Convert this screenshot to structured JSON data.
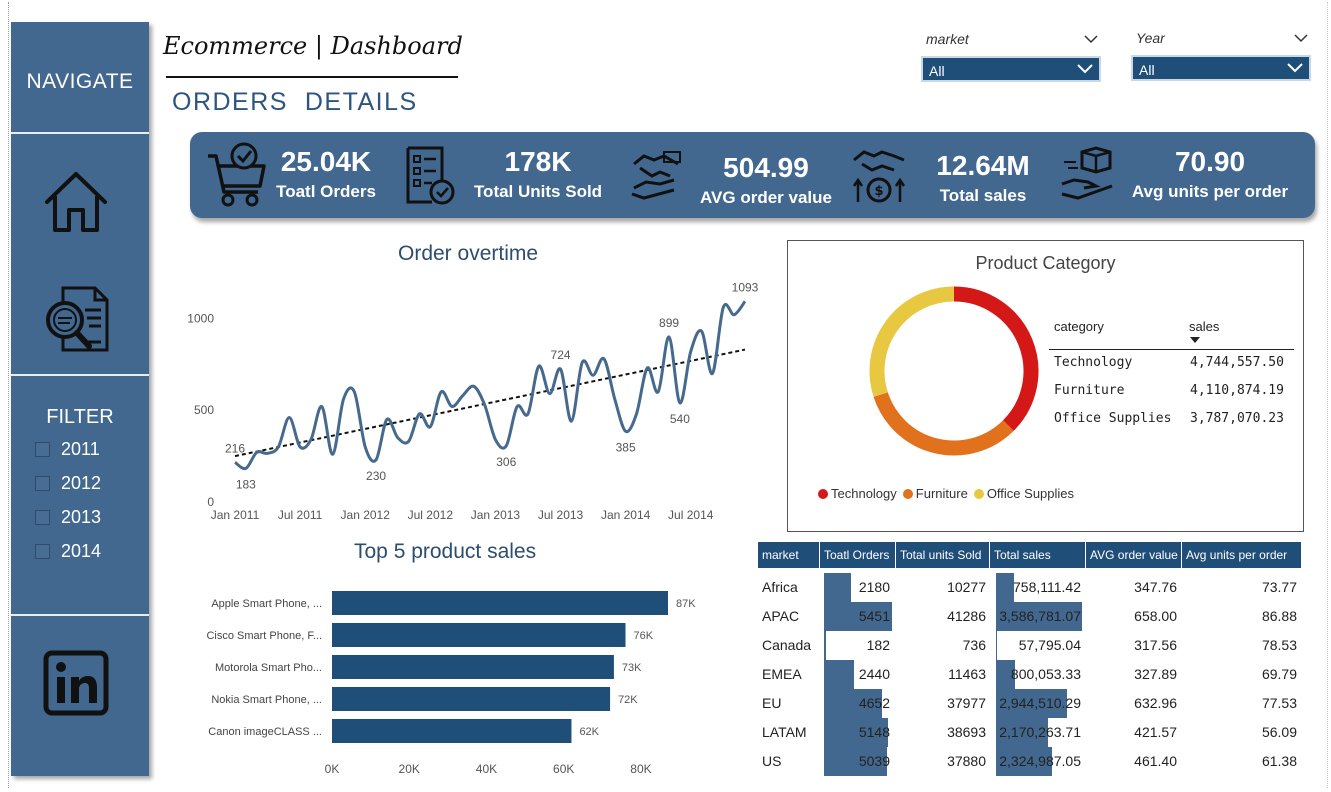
{
  "header": {
    "title": "Ecommerce | Dashboard",
    "section": "ORDERS  DETAILS"
  },
  "sidebar": {
    "navigate_label": "NAVIGATE",
    "filter_label": "FILTER",
    "years": [
      "2011",
      "2012",
      "2013",
      "2014"
    ],
    "icons": [
      "home-icon",
      "report-search-icon",
      "linkedin-icon"
    ]
  },
  "slicers": {
    "market": {
      "label": "market",
      "value": "All"
    },
    "year": {
      "label": "Year",
      "value": "All"
    }
  },
  "kpis": [
    {
      "value": "25.04K",
      "label": "Toatl Orders",
      "icon": "cart-icon"
    },
    {
      "value": "178K",
      "label": "Total Units Sold",
      "icon": "checklist-icon"
    },
    {
      "value": "504.99",
      "label": "AVG order value",
      "icon": "handshake-money-icon"
    },
    {
      "value": "12.64M",
      "label": "Total sales",
      "icon": "handshake-dollar-icon"
    },
    {
      "value": "70.90",
      "label": "Avg units per order",
      "icon": "box-hand-icon"
    }
  ],
  "colors": {
    "brand": "#426890",
    "dark": "#1f4e79",
    "technology": "#d41818",
    "furniture": "#e2711d",
    "office_supplies": "#e8c840"
  },
  "order_overtime": {
    "title": "Order overtime",
    "chart_data": {
      "type": "line",
      "x_ticks": [
        "Jan 2011",
        "Jul 2011",
        "Jan 2012",
        "Jul 2012",
        "Jan 2013",
        "Jul 2013",
        "Jan 2014",
        "Jul 2014"
      ],
      "y_ticks": [
        "0",
        "500",
        "1000"
      ],
      "ylim": [
        0,
        1100
      ],
      "months": [
        "Jan 2011",
        "Feb 2011",
        "Mar 2011",
        "Apr 2011",
        "May 2011",
        "Jun 2011",
        "Jul 2011",
        "Aug 2011",
        "Sep 2011",
        "Oct 2011",
        "Nov 2011",
        "Dec 2011",
        "Jan 2012",
        "Feb 2012",
        "Mar 2012",
        "Apr 2012",
        "May 2012",
        "Jun 2012",
        "Jul 2012",
        "Aug 2012",
        "Sep 2012",
        "Oct 2012",
        "Nov 2012",
        "Dec 2012",
        "Jan 2013",
        "Feb 2013",
        "Mar 2013",
        "Apr 2013",
        "May 2013",
        "Jun 2013",
        "Jul 2013",
        "Aug 2013",
        "Sep 2013",
        "Oct 2013",
        "Nov 2013",
        "Dec 2013",
        "Jan 2014",
        "Feb 2014",
        "Mar 2014",
        "Apr 2014",
        "May 2014",
        "Jun 2014",
        "Jul 2014",
        "Aug 2014",
        "Sep 2014",
        "Oct 2014",
        "Nov 2014",
        "Dec 2014"
      ],
      "values": [
        216,
        183,
        270,
        265,
        300,
        460,
        300,
        340,
        520,
        260,
        560,
        600,
        300,
        230,
        450,
        350,
        330,
        480,
        410,
        600,
        520,
        580,
        630,
        530,
        340,
        306,
        520,
        480,
        740,
        590,
        724,
        440,
        760,
        690,
        780,
        560,
        385,
        480,
        730,
        600,
        899,
        540,
        820,
        930,
        700,
        1060,
        1020,
        1093
      ],
      "data_labels": [
        {
          "index": 0,
          "text": "216",
          "pos": "above"
        },
        {
          "index": 1,
          "text": "183",
          "pos": "below"
        },
        {
          "index": 13,
          "text": "230",
          "pos": "below"
        },
        {
          "index": 25,
          "text": "306",
          "pos": "below"
        },
        {
          "index": 30,
          "text": "724",
          "pos": "above"
        },
        {
          "index": 36,
          "text": "385",
          "pos": "below"
        },
        {
          "index": 40,
          "text": "899",
          "pos": "above"
        },
        {
          "index": 41,
          "text": "540",
          "pos": "below"
        },
        {
          "index": 47,
          "text": "1093",
          "pos": "above"
        }
      ],
      "trendline": {
        "start": 250,
        "end": 830
      }
    }
  },
  "product_category": {
    "title": "Product Category",
    "col_category": "category",
    "col_sales": "sales",
    "chart_data": {
      "type": "pie",
      "categories": [
        "Technology",
        "Furniture",
        "Office Supplies"
      ],
      "values": [
        4744557.5,
        4110874.19,
        3787070.23
      ]
    },
    "rows": [
      {
        "category": "Technology",
        "sales": "4,744,557.50"
      },
      {
        "category": "Furniture",
        "sales": "4,110,874.19"
      },
      {
        "category": "Office Supplies",
        "sales": "3,787,070.23"
      }
    ]
  },
  "top5": {
    "title": "Top 5 product sales",
    "chart_data": {
      "type": "bar",
      "categories": [
        "Apple Smart Phone, ...",
        "Cisco Smart Phone, F...",
        "Motorola Smart Pho...",
        "Nokia Smart Phone, ...",
        "Canon imageCLASS ..."
      ],
      "values": [
        87,
        76,
        73,
        72,
        62
      ],
      "value_labels": [
        "87K",
        "76K",
        "73K",
        "72K",
        "62K"
      ],
      "x_ticks": [
        "0K",
        "20K",
        "40K",
        "60K",
        "80K"
      ],
      "xlim": [
        0,
        87
      ]
    }
  },
  "market_table": {
    "headers": [
      "market",
      "Toatl Orders",
      "Total units Sold",
      "Total sales",
      "AVG order value",
      "Avg units per order"
    ],
    "rows": [
      {
        "market": "Africa",
        "orders": "2180",
        "orders_n": 2180,
        "units": "10277",
        "sales": "758,111.42",
        "sales_n": 758111.42,
        "aov": "347.76",
        "upo": "73.77"
      },
      {
        "market": "APAC",
        "orders": "5451",
        "orders_n": 5451,
        "units": "41286",
        "sales": "3,586,781.07",
        "sales_n": 3586781.07,
        "aov": "658.00",
        "upo": "86.88"
      },
      {
        "market": "Canada",
        "orders": "182",
        "orders_n": 182,
        "units": "736",
        "sales": "57,795.04",
        "sales_n": 57795.04,
        "aov": "317.56",
        "upo": "78.53"
      },
      {
        "market": "EMEA",
        "orders": "2440",
        "orders_n": 2440,
        "units": "11463",
        "sales": "800,053.33",
        "sales_n": 800053.33,
        "aov": "327.89",
        "upo": "69.79"
      },
      {
        "market": "EU",
        "orders": "4652",
        "orders_n": 4652,
        "units": "37977",
        "sales": "2,944,510.29",
        "sales_n": 2944510.29,
        "aov": "632.96",
        "upo": "77.53"
      },
      {
        "market": "LATAM",
        "orders": "5148",
        "orders_n": 5148,
        "units": "38693",
        "sales": "2,170,263.71",
        "sales_n": 2170263.71,
        "aov": "421.57",
        "upo": "56.09"
      },
      {
        "market": "US",
        "orders": "5039",
        "orders_n": 5039,
        "units": "37880",
        "sales": "2,324,987.05",
        "sales_n": 2324987.05,
        "aov": "461.40",
        "upo": "61.38"
      }
    ]
  }
}
